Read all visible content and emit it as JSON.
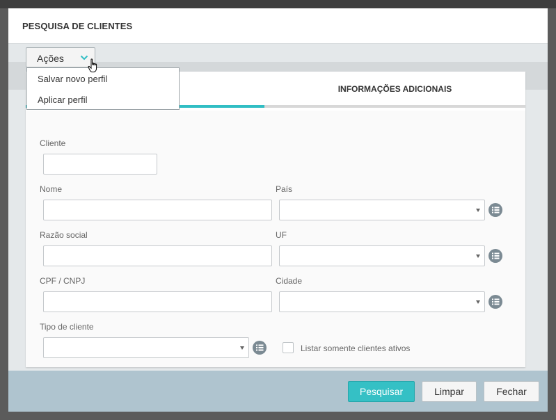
{
  "modal": {
    "title": "PESQUISA DE CLIENTES"
  },
  "actions": {
    "label": "Ações",
    "menu": [
      {
        "label": "Salvar novo perfil"
      },
      {
        "label": "Aplicar perfil"
      }
    ]
  },
  "tabs": [
    {
      "label": "",
      "active": true
    },
    {
      "label": "INFORMAÇÕES ADICIONAIS",
      "active": false
    }
  ],
  "form": {
    "cliente": {
      "label": "Cliente",
      "value": ""
    },
    "nome": {
      "label": "Nome",
      "value": ""
    },
    "pais": {
      "label": "País",
      "value": ""
    },
    "razao_social": {
      "label": "Razão social",
      "value": ""
    },
    "uf": {
      "label": "UF",
      "value": ""
    },
    "cpf_cnpj": {
      "label": "CPF / CNPJ",
      "value": ""
    },
    "cidade": {
      "label": "Cidade",
      "value": ""
    },
    "tipo_cliente": {
      "label": "Tipo de cliente",
      "value": ""
    },
    "somente_ativos": {
      "label": "Listar somente clientes ativos",
      "checked": false
    }
  },
  "footer": {
    "search_label": "Pesquisar",
    "clear_label": "Limpar",
    "close_label": "Fechar"
  },
  "colors": {
    "accent": "#35c0c5",
    "footer_bg": "#afc4cf",
    "icon_gray": "#7b8a93"
  },
  "icons": {
    "dropdown_toggle": "chevron-down-icon",
    "cursor": "hand-pointer-icon",
    "lookup": "list-icon",
    "select_caret": "caret-down-icon"
  }
}
